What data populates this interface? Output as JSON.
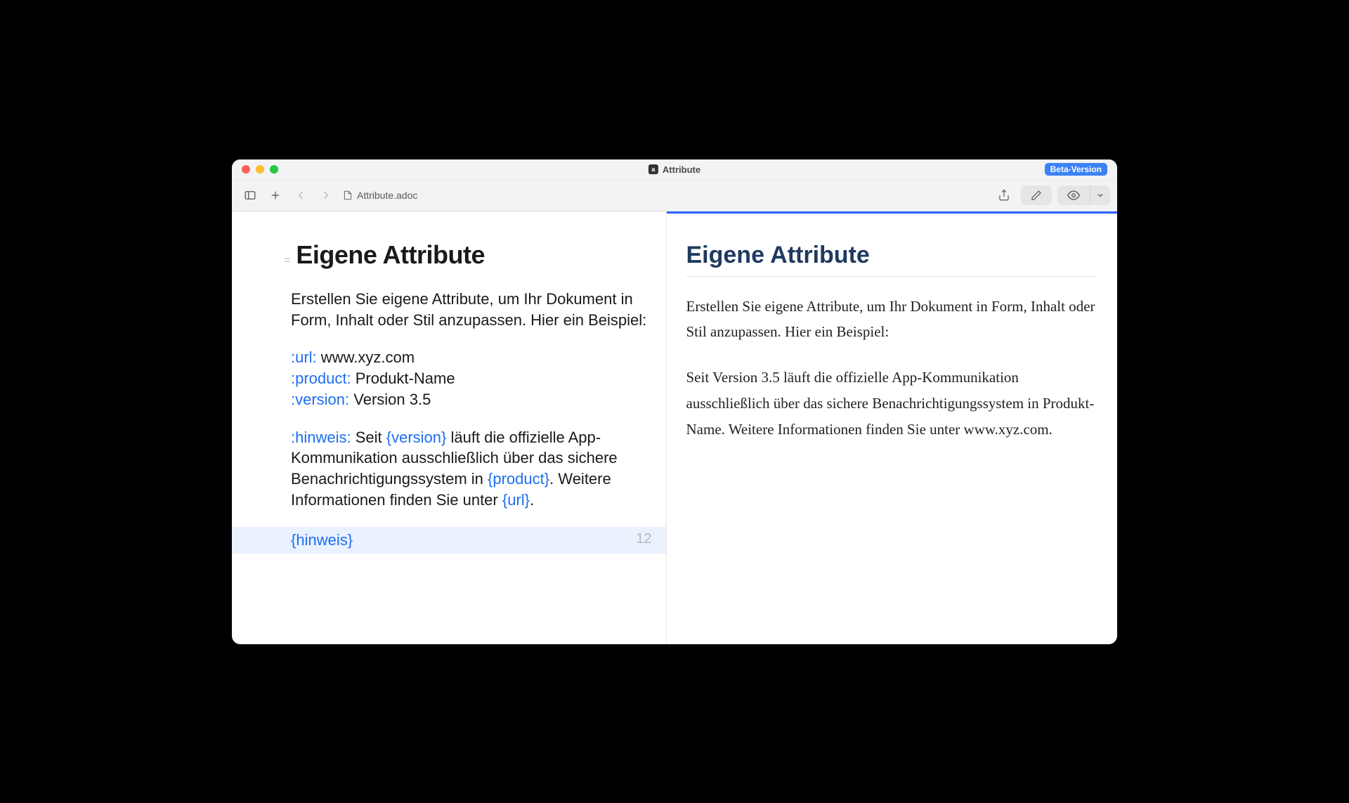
{
  "window": {
    "title": "Attribute",
    "beta_label": "Beta-Version"
  },
  "toolbar": {
    "filename": "Attribute.adoc"
  },
  "editor": {
    "heading_marker": "=",
    "heading": "Eigene Attribute",
    "intro": "Erstellen Sie eigene Attribute, um Ihr Dokument in Form, Inhalt oder Stil anzupassen. Hier ein Beispiel:",
    "attrs": {
      "url_key": ":url:",
      "url_val": " www.xyz.com",
      "product_key": ":product:",
      "product_val": " Produkt-Name",
      "version_key": ":version:",
      "version_val": " Version 3.5"
    },
    "hinweis": {
      "key": ":hinweis:",
      "t1": " Seit ",
      "ref_version": "{version}",
      "t2": " läuft die offizielle App-Kommunikation ausschließlich über das sichere Benachrichtigungssystem in ",
      "ref_product": "{product}",
      "t3": ". Weitere Informationen finden Sie unter ",
      "ref_url": "{url}",
      "t4": "."
    },
    "current_ref": "{hinweis}",
    "current_lineno": "12"
  },
  "preview": {
    "heading": "Eigene Attribute",
    "p1": "Erstellen Sie eigene Attribute, um Ihr Dokument in Form, Inhalt oder Stil anzupassen. Hier ein Beispiel:",
    "p2": "Seit Version 3.5 läuft die offizielle App-Kommunikation ausschließlich über das sichere Benachrichtigungssys­tem in Produkt-Name. Weitere Informationen finden Sie unter www.xyz.com."
  }
}
